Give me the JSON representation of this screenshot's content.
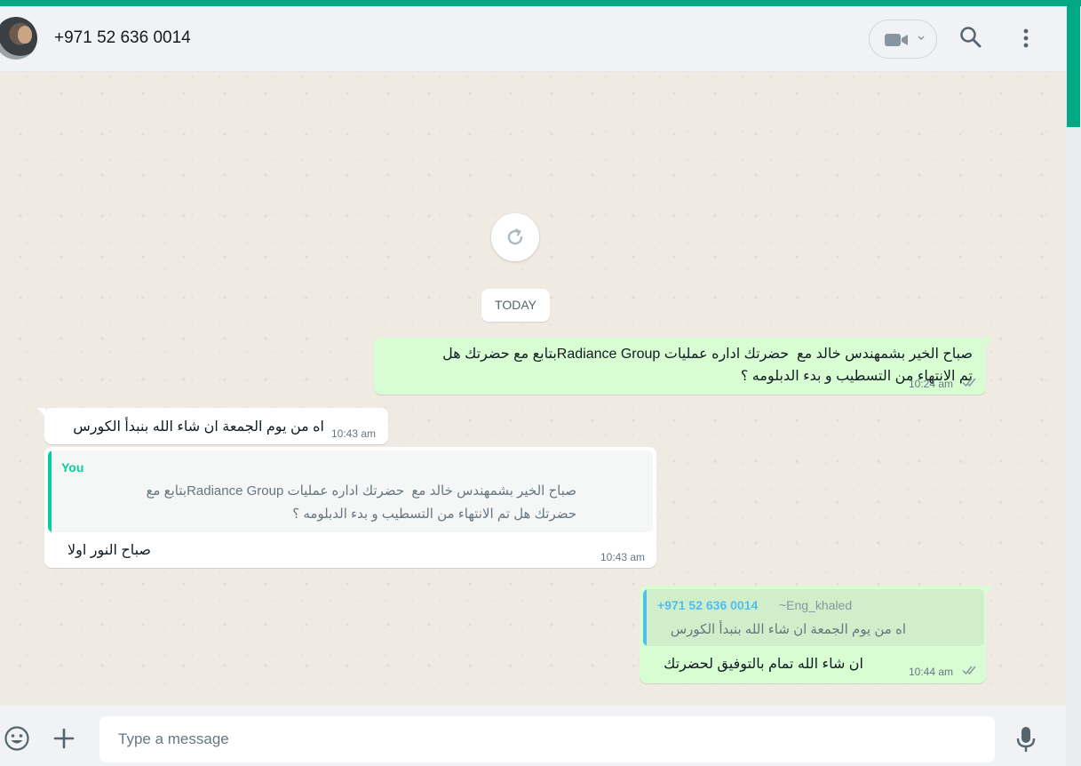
{
  "header": {
    "contact_name": "+971 52 636 0014"
  },
  "chat": {
    "date_chip": "TODAY",
    "messages": [
      {
        "direction": "out",
        "text": "صباح الخير بشمهندس خالد مع  حضرتك اداره عمليات Radiance Groupبتابع مع حضرتك هل\nتم الانتهاء من التسطيب و بدء الدبلومه ؟",
        "time": "10:24 am"
      },
      {
        "direction": "in",
        "text": "اه من يوم الجمعة ان شاء الله بنبدأ الكورس",
        "time": "10:43 am"
      },
      {
        "direction": "in",
        "quote_author": "You",
        "quote_text": "صباح الخير بشمهندس خالد مع  حضرتك اداره عمليات Radiance Groupبتابع مع\nحضرتك هل تم الانتهاء من التسطيب و بدء الدبلومه ؟",
        "text": "صباح النور اولا",
        "time": "10:43 am"
      },
      {
        "direction": "out",
        "quote_author": "+971 52 636 0014",
        "quote_pushname": "~Eng_khaled",
        "quote_text": "اه من يوم الجمعة ان شاء الله بنبدأ الكورس",
        "text": "ان شاء الله تمام بالتوفيق لحضرتك",
        "time": "10:44 am"
      }
    ]
  },
  "composer": {
    "placeholder": "Type a message"
  },
  "icons": {
    "video_call": "video-camera-icon",
    "dropdown": "chevron-down-icon",
    "search": "search-icon",
    "menu": "more-vertical-icon",
    "refresh": "refresh-icon",
    "emoji": "emoji-icon",
    "attach": "plus-icon",
    "voice": "microphone-icon",
    "read_receipt": "double-check-icon"
  },
  "colors": {
    "accent": "#00a884",
    "outgoing_bubble": "#d9fdd3",
    "incoming_bubble": "#ffffff",
    "quote_you": "#06cf9c",
    "quote_contact": "#53bdeb"
  }
}
